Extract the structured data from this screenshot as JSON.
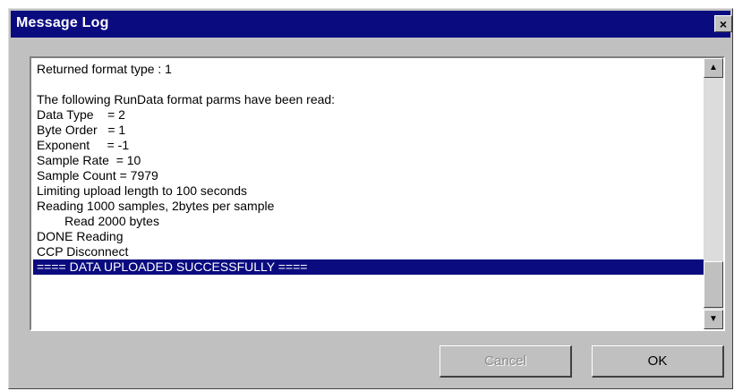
{
  "window": {
    "title": "Message Log",
    "close_label": "×"
  },
  "log": {
    "lines": [
      "Returned format type : 1",
      "",
      "The following RunData format parms have been read:",
      "Data Type    = 2",
      "Byte Order   = 1",
      "Exponent     = -1",
      "Sample Rate  = 10",
      "Sample Count = 7979",
      "Limiting upload length to 100 seconds",
      "Reading 1000 samples, 2bytes per sample",
      "        Read 2000 bytes",
      "DONE Reading",
      "CCP Disconnect",
      "==== DATA UPLOADED SUCCESSFULLY ===="
    ],
    "selected_index": 13
  },
  "scrollbar": {
    "up_arrow": "▲",
    "down_arrow": "▼"
  },
  "buttons": {
    "cancel_label": "Cancel",
    "ok_label": "OK"
  }
}
